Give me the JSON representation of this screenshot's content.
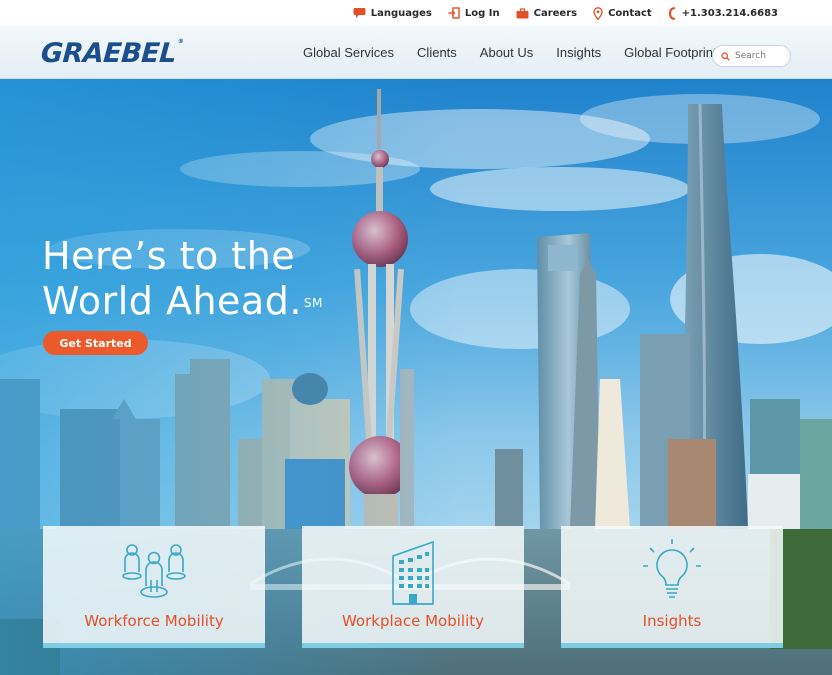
{
  "utility": {
    "languages": "Languages",
    "login": "Log In",
    "careers": "Careers",
    "contact": "Contact",
    "phone": "+1.303.214.6683"
  },
  "brand": {
    "logo_text": "GRAEBEL",
    "logo_mark": "®"
  },
  "nav": {
    "items": [
      {
        "label": "Global Services"
      },
      {
        "label": "Clients"
      },
      {
        "label": "About Us"
      },
      {
        "label": "Insights"
      },
      {
        "label": "Global Footprint"
      }
    ],
    "search_placeholder": "Search"
  },
  "hero": {
    "headline_line1": "Here’s to the",
    "headline_line2": "World Ahead.",
    "headline_mark": "SM",
    "cta_label": "Get Started"
  },
  "cards": [
    {
      "label": "Workforce Mobility",
      "icon": "people-icon"
    },
    {
      "label": "Workplace Mobility",
      "icon": "building-icon"
    },
    {
      "label": "Insights",
      "icon": "lightbulb-icon"
    }
  ],
  "colors": {
    "accent": "#ec5a2c",
    "brand_blue": "#1a4e8c",
    "card_accent": "#7fcde2",
    "icon_teal": "#3aa8c8"
  }
}
